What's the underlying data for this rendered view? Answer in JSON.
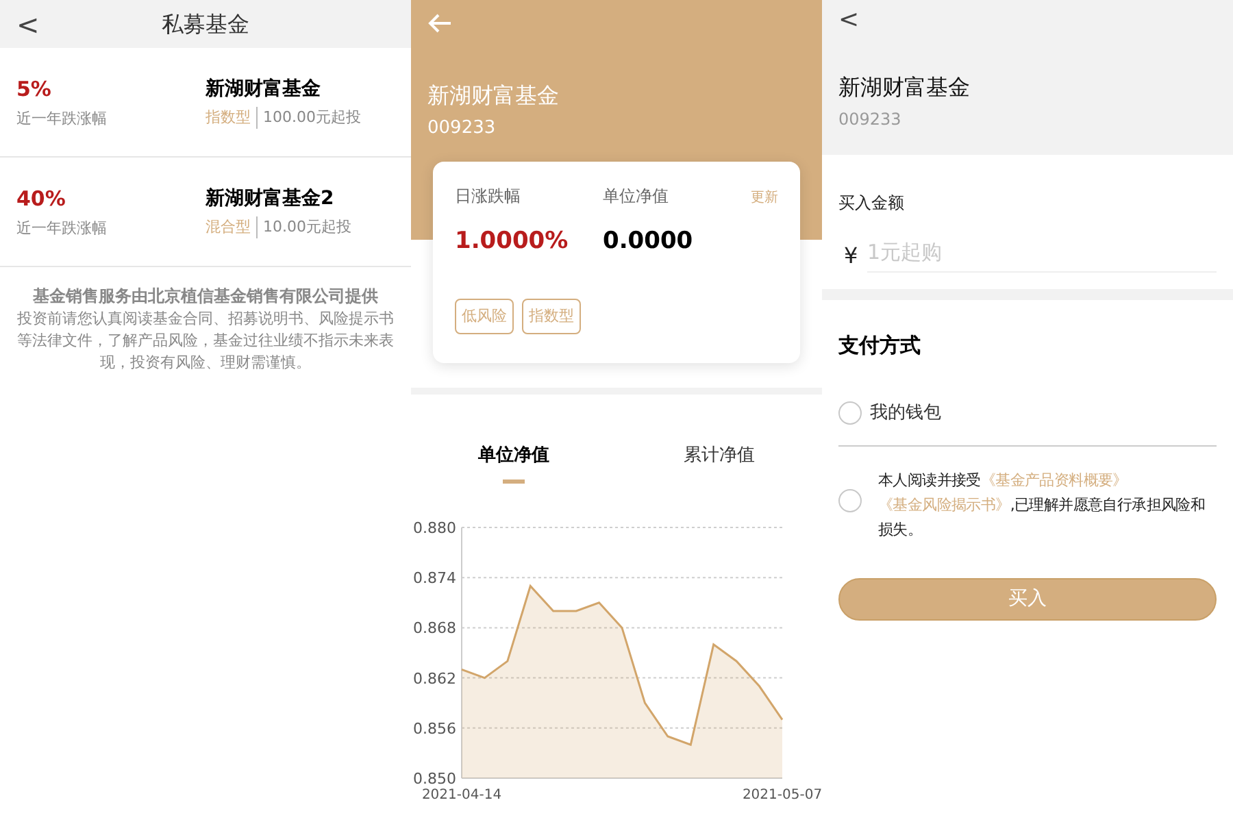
{
  "list_page": {
    "title": "私募基金",
    "back": "<",
    "funds": [
      {
        "change": "5%",
        "change_label": "近一年跌涨幅",
        "name": "新湖财富基金",
        "type": "指数型",
        "min": "100.00元起投"
      },
      {
        "change": "40%",
        "change_label": "近一年跌涨幅",
        "name": "新湖财富基金2",
        "type": "混合型",
        "min": "10.00元起投"
      }
    ],
    "disclaimer_title": "基金销售服务由北京植信基金销售有限公司提供",
    "disclaimer": "投资前请您认真阅读基金合同、招募说明书、风险提示书等法律文件，了解产品风险，基金过往业绩不指示未来表现，投资有风险、理财需谨慎。"
  },
  "detail_page": {
    "name": "新湖财富基金",
    "code": "009233",
    "stats": [
      {
        "label": "日涨跌幅",
        "value": "1.0000%",
        "kind": "change"
      },
      {
        "label": "单位净值",
        "value": "0.0000",
        "kind": "nav"
      }
    ],
    "update": "更新",
    "tags": [
      "低风险",
      "指数型"
    ],
    "tabs": [
      {
        "label": "单位净值",
        "selected": true
      },
      {
        "label": "累计净值",
        "selected": false
      }
    ],
    "chart_data": {
      "type": "area",
      "categories": [
        "2021-04-14",
        null,
        null,
        null,
        null,
        null,
        null,
        null,
        null,
        null,
        null,
        null,
        null,
        null,
        "2021-05-07"
      ],
      "series": [
        {
          "color": "#d2a56a",
          "values": [
            0.863,
            0.862,
            0.864,
            0.873,
            0.87,
            0.87,
            0.871,
            0.868,
            0.859,
            0.855,
            0.854,
            0.866,
            0.864,
            0.861,
            0.857
          ]
        }
      ],
      "ylim": [
        0.85,
        0.88
      ],
      "grid": true,
      "yticks": [
        {
          "value": 0.85,
          "label": "0.850"
        },
        {
          "value": 0.856,
          "label": "0.856"
        },
        {
          "value": 0.862,
          "label": "0.862"
        },
        {
          "value": 0.868,
          "label": "0.868"
        },
        {
          "value": 0.874,
          "label": "0.874"
        },
        {
          "value": 0.88,
          "label": "0.880"
        }
      ]
    }
  },
  "buy_page": {
    "back": "<",
    "name": "新湖财富基金",
    "code": "009233",
    "amount_label": "买入金额",
    "currency": "¥",
    "amount_placeholder": "1元起购",
    "payment_title": "支付方式",
    "payment_options": [
      {
        "label": "我的钱包",
        "selected": false
      }
    ],
    "agreement": {
      "checked": false,
      "parts": [
        {
          "text": "本人阅读并接受",
          "kind": "text"
        },
        {
          "text": "《基金产品资料概要》",
          "kind": "link"
        },
        {
          "text": "《基金风险揭示书》",
          "kind": "link"
        },
        {
          "text": ",已理解并愿意自行承担风险和损失。",
          "kind": "text"
        }
      ]
    },
    "buy_button": "买入"
  }
}
